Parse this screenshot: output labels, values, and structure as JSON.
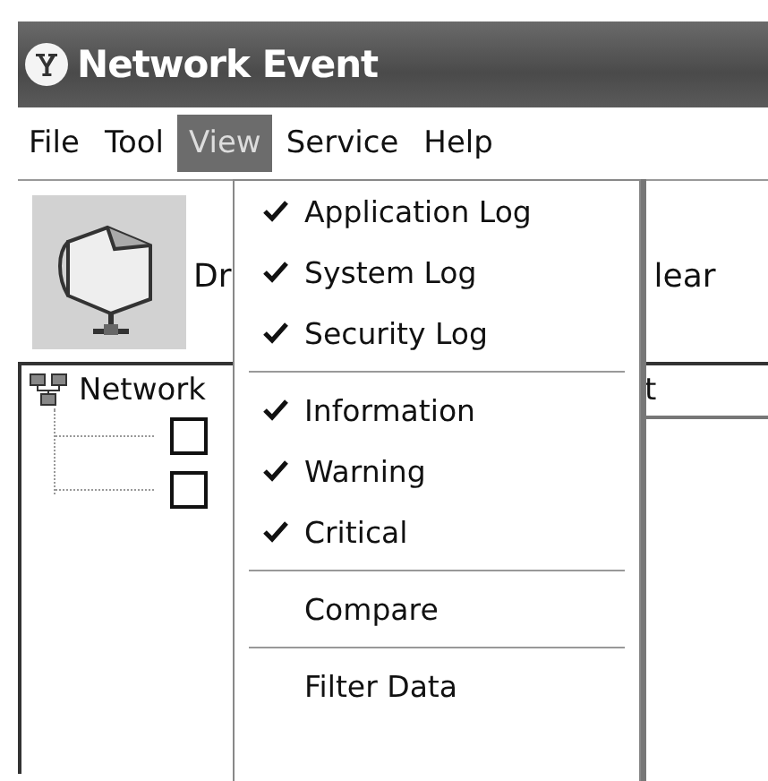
{
  "window": {
    "title": "Network Event"
  },
  "menu_bar": [
    {
      "label": "File",
      "selected": false
    },
    {
      "label": "Tool",
      "selected": false
    },
    {
      "label": "View",
      "selected": true
    },
    {
      "label": "Service",
      "selected": false
    },
    {
      "label": "Help",
      "selected": false
    }
  ],
  "toolbar": [
    {
      "label": "Dr"
    },
    {
      "label": "lear"
    }
  ],
  "tree": {
    "root": "Network",
    "items": [
      {
        "checked": false
      },
      {
        "checked": false
      }
    ]
  },
  "list_header": {
    "column_1": "t"
  },
  "view_menu": [
    {
      "kind": "check",
      "label": "Application Log",
      "checked": true
    },
    {
      "kind": "check",
      "label": "System Log",
      "checked": true
    },
    {
      "kind": "check",
      "label": "Security Log",
      "checked": true
    },
    {
      "kind": "separator"
    },
    {
      "kind": "check",
      "label": "Information",
      "checked": true
    },
    {
      "kind": "check",
      "label": "Warning",
      "checked": true
    },
    {
      "kind": "check",
      "label": "Critical",
      "checked": true
    },
    {
      "kind": "separator"
    },
    {
      "kind": "item",
      "label": "Compare"
    },
    {
      "kind": "separator"
    },
    {
      "kind": "item",
      "label": "Filter Data"
    }
  ]
}
